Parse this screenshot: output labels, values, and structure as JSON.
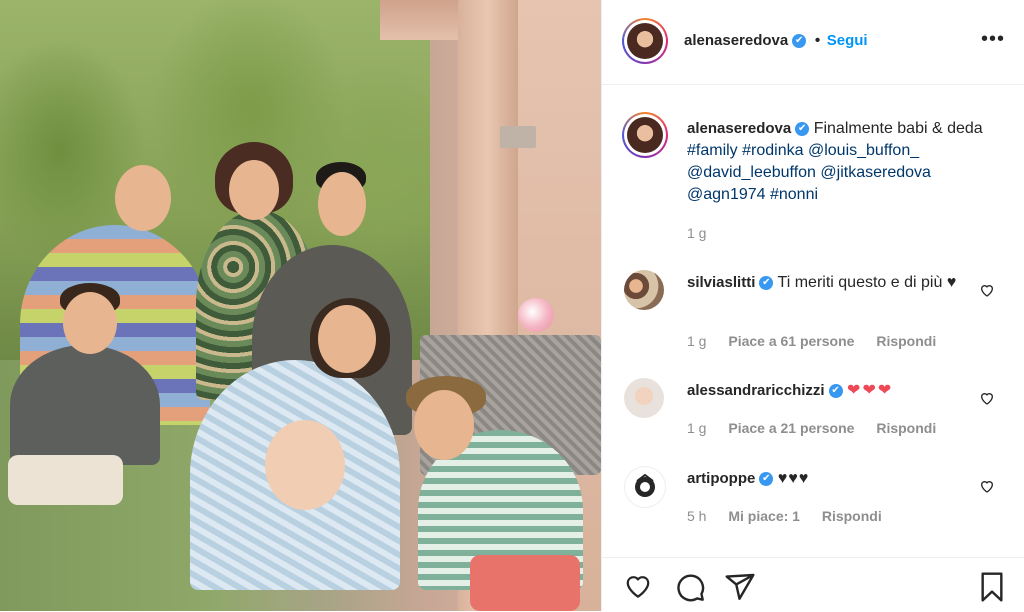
{
  "post": {
    "username": "alenaseredova",
    "verified_mark": "✔",
    "follow_separator": "•",
    "follow_label": "Segui",
    "more_icon": "more-horizontal-icon",
    "caption": {
      "text_start": "Finalmente babi & deda",
      "hashtags": [
        "#family",
        "#rodinka"
      ],
      "mentions": [
        "@louis_buffon_",
        "@david_leebuffon",
        "@jitkaseredova",
        "@agn1974"
      ],
      "hashtag_end": "#nonni",
      "time": "1 g"
    }
  },
  "comments": [
    {
      "username": "silviaslitti",
      "text": "Ti meriti questo e di più ♥",
      "time": "1 g",
      "likes": "Piace a 61 persone",
      "reply": "Rispondi"
    },
    {
      "username": "alessandraricchizzi",
      "text": "❤❤❤",
      "time": "1 g",
      "likes": "Piace a 21 persone",
      "reply": "Rispondi"
    },
    {
      "username": "artipoppe",
      "text": "♥♥♥",
      "time": "5 h",
      "likes": "Mi piace: 1",
      "reply": "Rispondi"
    }
  ],
  "actions": {
    "icons": [
      "heart-icon",
      "comment-icon",
      "share-icon",
      "bookmark-icon"
    ]
  },
  "colors": {
    "accent": "#0095f6",
    "verified": "#3897f0",
    "text": "#262626",
    "muted": "#8e8e8e",
    "hashtag": "#00376b",
    "heart_red": "#ed4956"
  }
}
